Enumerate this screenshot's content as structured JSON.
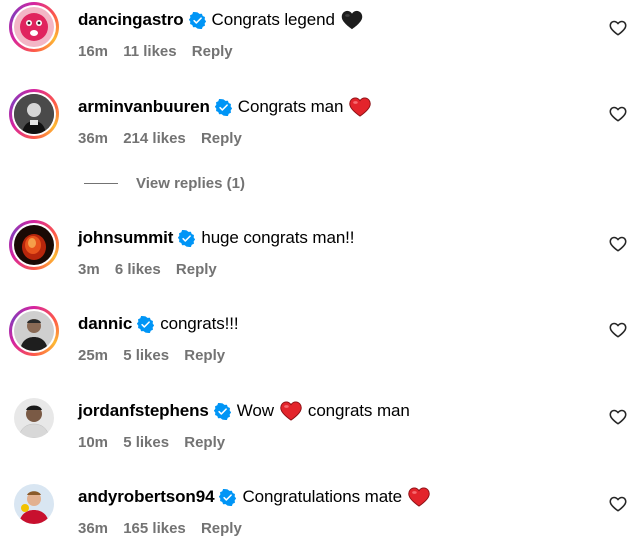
{
  "comments": [
    {
      "username": "dancingastro",
      "verified": true,
      "text": "Congrats legend",
      "emoji": "black-heart",
      "time": "16m",
      "likes": "11 likes",
      "reply": "Reply",
      "avatar": "pink-smiley-avatar",
      "story_ring": true
    },
    {
      "username": "arminvanbuuren",
      "verified": true,
      "text": "Congrats man",
      "emoji": "red-heart",
      "time": "36m",
      "likes": "214 likes",
      "reply": "Reply",
      "avatar": "bw-portrait-avatar",
      "story_ring": true
    },
    {
      "username": "johnsummit",
      "verified": true,
      "text": "huge congrats man!!",
      "time": "3m",
      "likes": "6 likes",
      "reply": "Reply",
      "avatar": "red-fire-avatar",
      "story_ring": true
    },
    {
      "username": "dannic",
      "verified": true,
      "text": "congrats!!!",
      "time": "25m",
      "likes": "5 likes",
      "reply": "Reply",
      "avatar": "man-portrait-avatar",
      "story_ring": true
    },
    {
      "username": "jordanfstephens",
      "verified": true,
      "text_before": "Wow",
      "emoji": "red-heart",
      "text_after": "congrats man",
      "time": "10m",
      "likes": "5 likes",
      "reply": "Reply",
      "avatar": "man-portrait-avatar",
      "story_ring": false
    },
    {
      "username": "andyrobertson94",
      "verified": true,
      "text": "Congratulations mate",
      "emoji": "red-heart",
      "time": "36m",
      "likes": "165 likes",
      "reply": "Reply",
      "avatar": "football-player-avatar",
      "story_ring": false
    }
  ],
  "view_replies": "View replies (1)",
  "colors": {
    "verified_blue": "#0095f6",
    "muted_text": "#737373",
    "heart_red": "#e3242b"
  },
  "icons": {
    "like": "heart-outline-icon",
    "verified": "verified-badge-icon"
  }
}
